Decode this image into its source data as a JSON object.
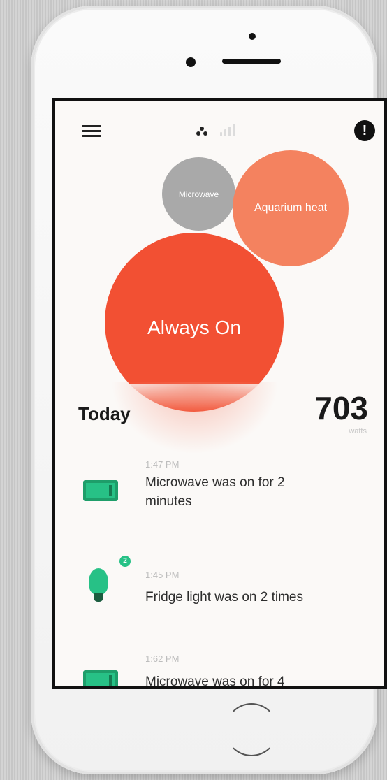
{
  "top_bar": {
    "menu_icon": "hamburger-menu-icon",
    "logo_icon": "three-dots-logo-icon",
    "signal_icon": "signal-bars-icon",
    "alert_icon": "exclamation-alert-icon",
    "alert_glyph": "!"
  },
  "bubbles": [
    {
      "label": "Microwave",
      "color": "#a9a9a9"
    },
    {
      "label": "Aquarium heat",
      "color": "#f4825f"
    },
    {
      "label": "Always On",
      "color": "#f25033"
    }
  ],
  "summary": {
    "period": "Today",
    "total": "703",
    "unit": "watts"
  },
  "feed": [
    {
      "time": "1:47 PM",
      "text": "Microwave was on for 2 minutes",
      "icon": "microwave-icon"
    },
    {
      "time": "1:45 PM",
      "text": "Fridge light was on 2 times",
      "icon": "light-bulb-icon",
      "badge": "2"
    },
    {
      "time": "1:62 PM",
      "text": "Microwave was on for 4",
      "icon": "microwave-icon"
    }
  ],
  "colors": {
    "accent_green": "#27c186",
    "always_on": "#f25033",
    "aquarium": "#f4825f",
    "microwave": "#a9a9a9"
  }
}
